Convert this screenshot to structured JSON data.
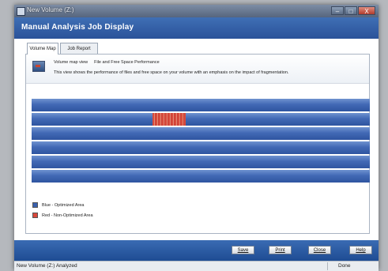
{
  "window": {
    "title": "New Volume (Z:)",
    "controls": {
      "minimize": "–",
      "maximize": "□",
      "close": "X"
    }
  },
  "header": {
    "title": "Manual Analysis Job Display"
  },
  "tabs": [
    {
      "label": "Volume Map",
      "active": true
    },
    {
      "label": "Job Report",
      "active": false
    }
  ],
  "info": {
    "view_label": "Volume map view",
    "view_name": "File and Free Space Performance",
    "description": "This view shows the performance of files and free space on your volume with an emphasis on the impact of fragmentation."
  },
  "volume_map": {
    "row_count": 6,
    "optimized_color": "#3a61ae",
    "non_optimized_color": "#d9483b"
  },
  "legend": [
    {
      "label": "Blue - Optimized Area",
      "color": "#3a61ae"
    },
    {
      "label": "Red - Non-Optimized Area",
      "color": "#d9483b"
    }
  ],
  "buttons": {
    "save": "Save",
    "print": "Print",
    "close": "Close",
    "help": "Help"
  },
  "status": {
    "left": "New Volume (Z:) Analyzed",
    "right": "Done"
  }
}
